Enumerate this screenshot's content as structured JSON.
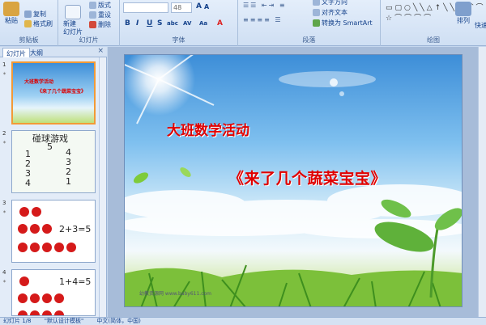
{
  "ribbon": {
    "clipboard": {
      "paste": "粘贴",
      "copy": "复制",
      "format_painter": "格式刷",
      "label": "剪贴板"
    },
    "slides": {
      "new_slide": "新建\n幻灯片",
      "layout": "版式",
      "reset": "重设",
      "delete": "删除",
      "label": "幻灯片"
    },
    "font": {
      "size": "48",
      "label": "字体",
      "buttons": [
        "B",
        "I",
        "U",
        "S",
        "abc",
        "AV",
        "Aa",
        "A"
      ]
    },
    "paragraph": {
      "text_direction": "文字方向",
      "align_text": "对齐文本",
      "smartart": "转换为 SmartArt",
      "label": "段落"
    },
    "drawing": {
      "arrange": "排列",
      "quick_styles": "快速",
      "label": "绘图",
      "shapes": "▭▢○╲╲△↑╲╲▭⌒⌒{}☆⌒⌒⌒⌒"
    }
  },
  "panel": {
    "tabs": [
      "幻灯片",
      "大纲"
    ],
    "close": "×",
    "slides": [
      {
        "num": "1",
        "title1": "大班数学活动",
        "title2": "《来了几个蔬菜宝宝》"
      },
      {
        "num": "2",
        "title": "碰球游戏",
        "top": "5",
        "left": [
          "1",
          "2",
          "3",
          "4"
        ],
        "right": [
          "4",
          "3",
          "2",
          "1"
        ]
      },
      {
        "num": "3",
        "equation": "2+3=5"
      },
      {
        "num": "4",
        "equation": "1+4=5"
      }
    ]
  },
  "slide": {
    "title1": "大班数学活动",
    "title2": "《来了几个蔬菜宝宝》",
    "watermark": "幼教资源网 www.baby611.com"
  },
  "status": {
    "slide_count": "幻灯片 1/8",
    "theme": "\"默认设计模板\"",
    "language": "中文(简体，中国)"
  }
}
